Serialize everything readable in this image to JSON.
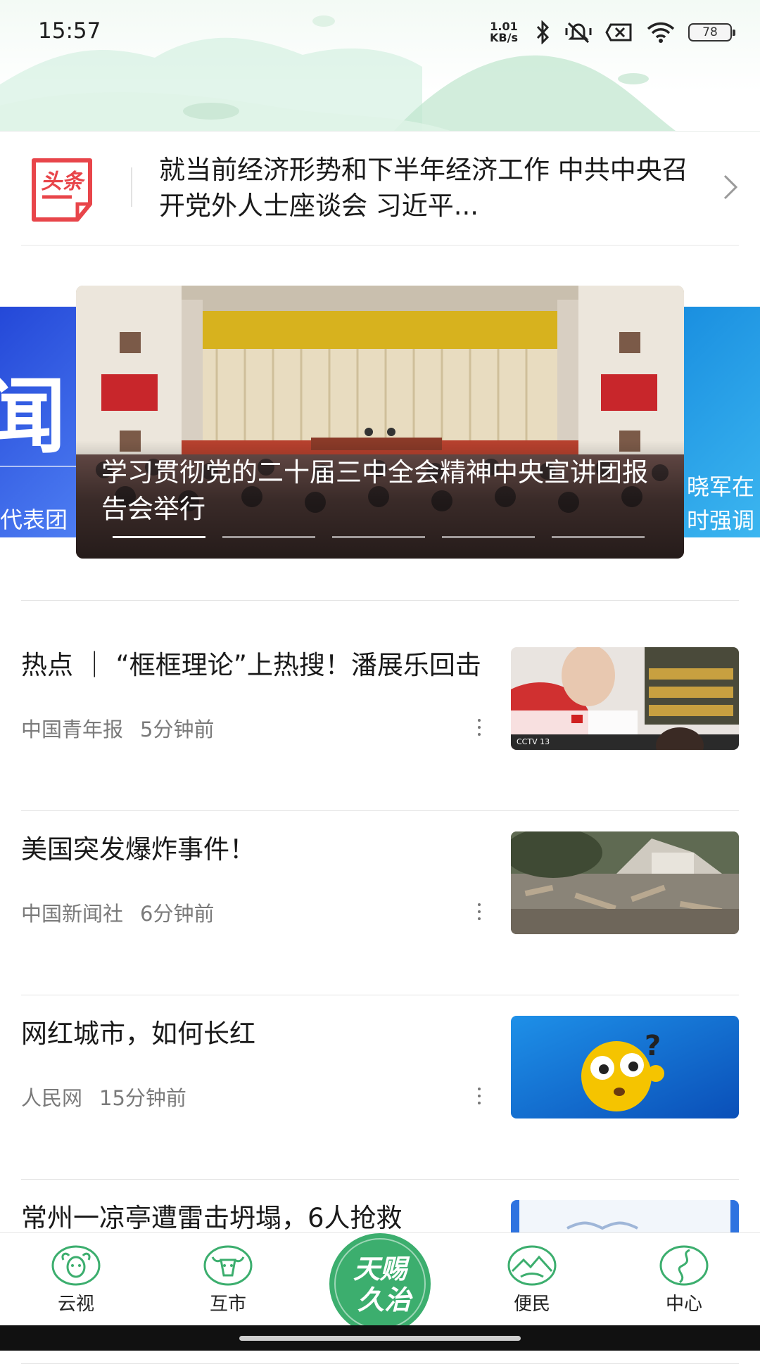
{
  "status_bar": {
    "time": "15:57",
    "net_speed_value": "1.01",
    "net_speed_unit": "KB/s",
    "battery": "78",
    "icons": [
      "bluetooth-icon",
      "mute-vibrate-icon",
      "sim-disabled-icon",
      "wifi-icon",
      "battery-icon"
    ]
  },
  "headline": {
    "logo_text": "头条",
    "text": "就当前经济形势和下半年经济工作 中共中央召开党外人士座谈会 习近平...",
    "arrow_icon": "chevron-right-icon"
  },
  "carousel": {
    "left_peek": {
      "big_char": "闻",
      "caption": "代表团"
    },
    "active": {
      "title": "学习贯彻党的二十届三中全会精神中央宣讲团报告会举行"
    },
    "right_peek": {
      "caption": "晓军在时强调"
    },
    "indicator_count": 5,
    "active_index": 0
  },
  "news": [
    {
      "title": "热点 ｜ “框框理论”上热搜！潘展乐回击",
      "source": "中国青年报",
      "time": "5分钟前",
      "thumb": "swimmer-interview-image",
      "thumb_text": "CCTV 13"
    },
    {
      "title": "美国突发爆炸事件！",
      "source": "中国新闻社",
      "time": "6分钟前",
      "thumb": "explosion-debris-image"
    },
    {
      "title": "网红城市，如何长红",
      "source": "人民网",
      "time": "15分钟前",
      "thumb": "confused-emoji-image"
    },
    {
      "title": "常州一凉亭遭雷击坍塌，6人抢救",
      "thumb": "partial-image"
    }
  ],
  "bottom_nav": {
    "items": [
      {
        "label": "云视",
        "icon": "sheep-icon"
      },
      {
        "label": "互市",
        "icon": "yak-icon"
      },
      {
        "label": "便民",
        "icon": "mountain-road-icon"
      },
      {
        "label": "中心",
        "icon": "winding-road-icon"
      }
    ],
    "center_logo_line1": "天赐",
    "center_logo_line2": "久治"
  },
  "colors": {
    "accent_green": "#3cae6e",
    "headline_red": "#e8454a",
    "text_primary": "#1a1a1a",
    "text_meta": "#7a7a7a"
  }
}
